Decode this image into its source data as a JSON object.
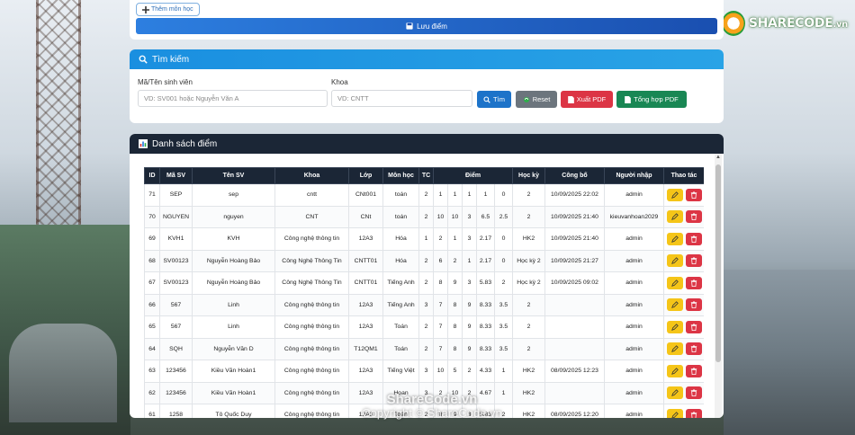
{
  "logo": {
    "text": "SHARECODE",
    "suffix": ".vn"
  },
  "top": {
    "add_subject_label": "Thêm môn học",
    "save_label": "Lưu điểm"
  },
  "search": {
    "title": "Tìm kiếm",
    "student_label": "Mã/Tên sinh viên",
    "student_placeholder": "VD: SV001 hoặc Nguyễn Văn A",
    "faculty_label": "Khoa",
    "faculty_placeholder": "VD: CNTT",
    "search_btn": "Tìm",
    "reset_btn": "Reset",
    "export_btn": "Xuất PDF",
    "summary_btn": "Tổng hợp PDF"
  },
  "list": {
    "title": "Danh sách điểm",
    "headers": [
      "ID",
      "Mã SV",
      "Tên SV",
      "Khoa",
      "Lớp",
      "Môn học",
      "TC",
      "Điểm",
      "Học kỳ",
      "Công bố",
      "Người nhập",
      "Thao tác"
    ],
    "rows": [
      [
        "71",
        "SEP",
        "sep",
        "cntt",
        "CNt001",
        "toán",
        "2",
        "1",
        "1",
        "1",
        "1",
        "0",
        "2",
        "10/09/2025 22:02",
        "admin"
      ],
      [
        "70",
        "NGUYEN",
        "nguyen",
        "CNT",
        "CNt",
        "toán",
        "2",
        "10",
        "10",
        "3",
        "6.5",
        "2.5",
        "2",
        "10/09/2025 21:40",
        "kieuvanhoan2029"
      ],
      [
        "69",
        "KVH1",
        "KVH",
        "Công nghệ thông tin",
        "12A3",
        "Hóa",
        "1",
        "2",
        "1",
        "3",
        "2.17",
        "0",
        "HK2",
        "10/09/2025 21:40",
        "admin"
      ],
      [
        "68",
        "SV00123",
        "Nguyễn Hoàng Bảo",
        "Công Nghệ Thông Tin",
        "CNTT01",
        "Hóa",
        "2",
        "6",
        "2",
        "1",
        "2.17",
        "0",
        "Học kỳ 2",
        "10/09/2025 21:27",
        "admin"
      ],
      [
        "67",
        "SV00123",
        "Nguyễn Hoàng Bảo",
        "Công Nghệ Thông Tin",
        "CNTT01",
        "Tiếng Anh",
        "2",
        "8",
        "9",
        "3",
        "5.83",
        "2",
        "Học kỳ 2",
        "10/09/2025 09:02",
        "admin"
      ],
      [
        "66",
        "567",
        "Linh",
        "Công nghệ thông tin",
        "12A3",
        "Tiếng Anh",
        "3",
        "7",
        "8",
        "9",
        "8.33",
        "3.5",
        "2",
        "",
        "admin"
      ],
      [
        "65",
        "567",
        "Linh",
        "Công nghệ thông tin",
        "12A3",
        "Toán",
        "2",
        "7",
        "8",
        "9",
        "8.33",
        "3.5",
        "2",
        "",
        "admin"
      ],
      [
        "64",
        "SQH",
        "Nguyễn Văn D",
        "Công nghệ thông tin",
        "T12QM1",
        "Toán",
        "2",
        "7",
        "8",
        "9",
        "8.33",
        "3.5",
        "2",
        "",
        "admin"
      ],
      [
        "63",
        "123456",
        "Kiều Văn Hoàn1",
        "Công nghệ thông tin",
        "12A3",
        "Tiếng Việt",
        "3",
        "10",
        "5",
        "2",
        "4.33",
        "1",
        "HK2",
        "08/09/2025 12:23",
        "admin"
      ],
      [
        "62",
        "123456",
        "Kiều Văn Hoàn1",
        "Công nghệ thông tin",
        "12A3",
        "Hoan",
        "3",
        "2",
        "10",
        "2",
        "4.67",
        "1",
        "HK2",
        "",
        "admin"
      ],
      [
        "61",
        "1258",
        "Tô Quốc Duy",
        "Công nghệ thông tin",
        "12A3",
        "Toán",
        "2",
        "8",
        "9",
        "3",
        "5.83",
        "2",
        "HK2",
        "08/09/2025 12:20",
        "admin"
      ]
    ]
  },
  "watermark": {
    "line1": "ShareCode.vn",
    "line2": "Copyright © ShareCode.vn"
  }
}
